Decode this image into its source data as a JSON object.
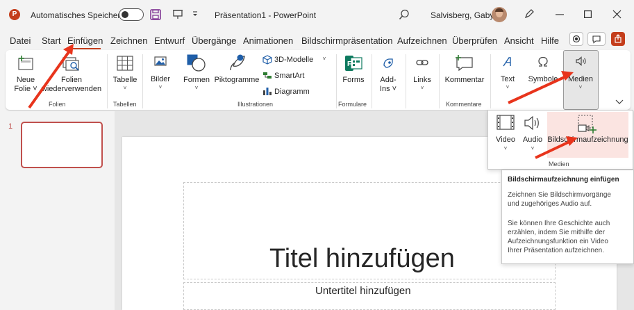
{
  "titlebar": {
    "autosave_label": "Automatisches Speichern",
    "doc_title": "Präsentation1  -  PowerPoint",
    "user_name": "Salvisberg, Gaby",
    "app_logo": "P"
  },
  "tabs": [
    "Datei",
    "Start",
    "Einfügen",
    "Zeichnen",
    "Entwurf",
    "Übergänge",
    "Animationen",
    "Bildschirmpräsentation",
    "Aufzeichnen",
    "Überprüfen",
    "Ansicht",
    "Hilfe"
  ],
  "ribbon": {
    "neue_folie_l1": "Neue",
    "neue_folie_l2": "Folie ˅",
    "folien_wiederverwenden_l1": "Folien",
    "folien_wiederverwenden_l2": "wiederverwenden",
    "tabelle": "Tabelle",
    "bilder": "Bilder",
    "formen": "Formen",
    "piktogramme": "Piktogramme",
    "modelle_3d": "3D-Modelle",
    "smartart": "SmartArt",
    "diagramm": "Diagramm",
    "forms": "Forms",
    "addins_l1": "Add-",
    "addins_l2": "Ins ˅",
    "links": "Links",
    "kommentar": "Kommentar",
    "text": "Text",
    "symbole": "Symbole",
    "medien": "Medien",
    "groups": {
      "folien": "Folien",
      "tabellen": "Tabellen",
      "illustrationen": "Illustrationen",
      "formulare": "Formulare",
      "kommentare": "Kommentare"
    }
  },
  "thumbnail": {
    "number": "1"
  },
  "slide": {
    "title_placeholder": "Titel hinzufügen",
    "subtitle_placeholder": "Untertitel hinzufügen"
  },
  "medien_dropdown": {
    "video": "Video",
    "audio": "Audio",
    "bildschirmaufzeichnung": "Bildschirmaufzeichnung",
    "group_label": "Medien"
  },
  "tooltip": {
    "title": "Bildschirmaufzeichnung einfügen",
    "lines": [
      "Zeichnen Sie Bildschirmvorgänge",
      "und zugehöriges Audio auf.",
      "",
      "Sie können Ihre Geschichte auch",
      "erzählen, indem Sie mithilfe der",
      "Aufzeichnungsfunktion ein Video",
      "Ihrer Präsentation aufzeichnen."
    ]
  },
  "colors": {
    "accent": "#c43e1c",
    "annotation_arrow": "#e8341c",
    "highlight": "#fbe4e1"
  }
}
